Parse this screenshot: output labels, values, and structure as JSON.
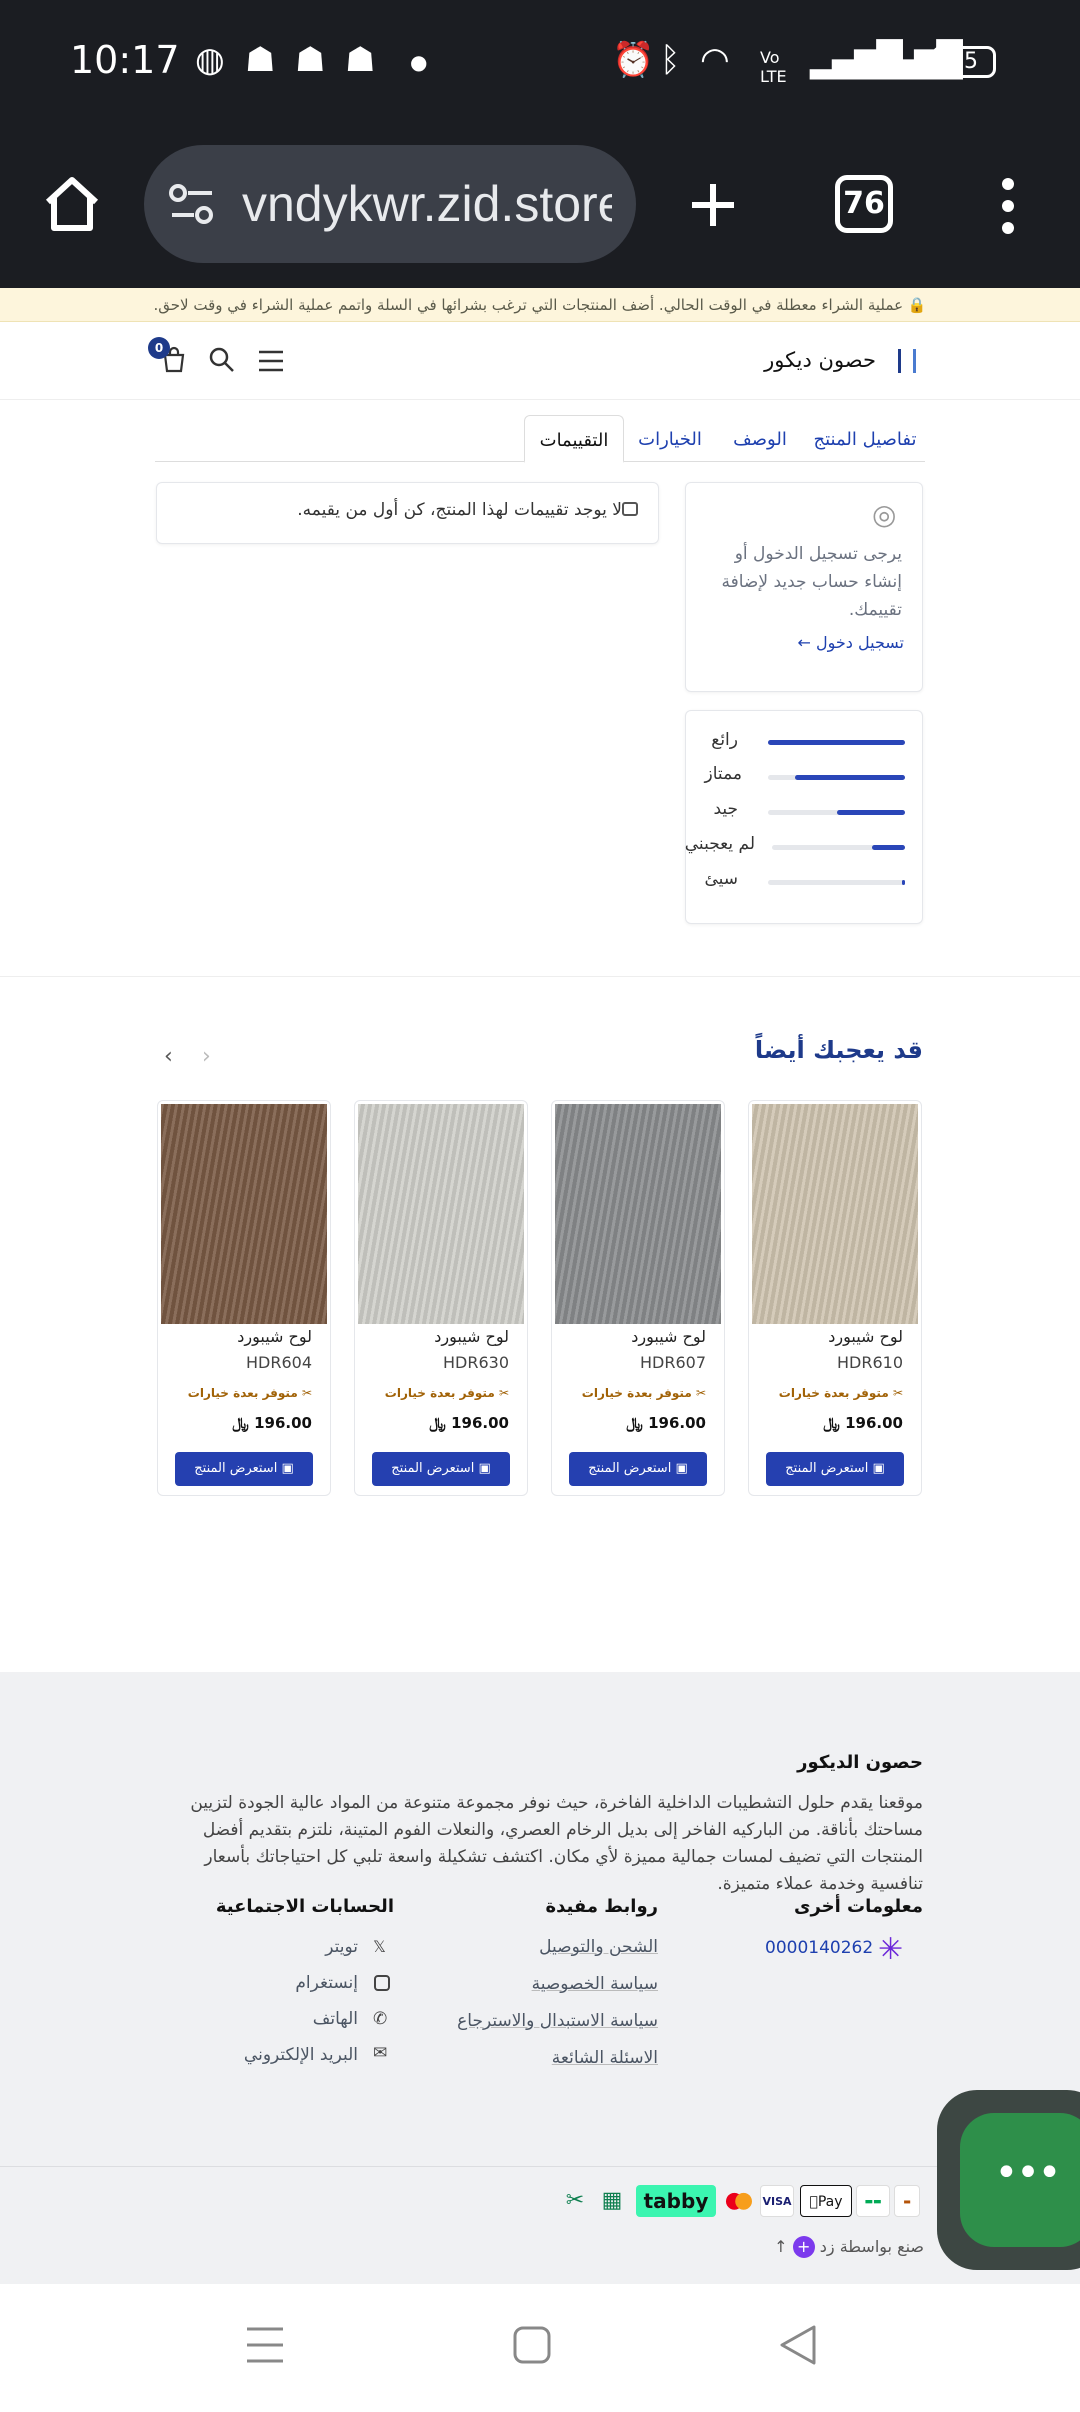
{
  "status": {
    "time": "10:17",
    "battery": "85"
  },
  "browser": {
    "url": "vndykwr.zid.store",
    "tab_count": "76"
  },
  "notice": "عملية الشراء معطلة في الوقت الحالي. أضف المنتجات التي ترغب بشرائها في السلة واتمم عملية الشراء في وقت لاحق.",
  "header": {
    "brand": "حصون ديكور",
    "cart_count": "0"
  },
  "tabs": [
    "تفاصيل المنتج",
    "الوصف",
    "الخيارات",
    "التقييمات"
  ],
  "reviews": {
    "empty": "لا يوجد تقييمات لهذا المنتج، كن أول من يقيمه.",
    "login_prompt": "يرجى تسجيل الدخول أو إنشاء حساب جديد لإضافة تقييمك.",
    "login_link": "تسجيل دخول ←",
    "levels": [
      {
        "label": "رائع",
        "fill": 1.0
      },
      {
        "label": "ممتاز",
        "fill": 0.8
      },
      {
        "label": "جيد",
        "fill": 0.5
      },
      {
        "label": "لم يعجبني",
        "fill": 0.25
      },
      {
        "label": "سيئ",
        "fill": 0.02
      }
    ]
  },
  "related": {
    "title": "قد يعجبك أيضاً",
    "products": [
      {
        "name": "لوح شيبورد",
        "code": "HDR610",
        "availability": "متوفر بعدة خيارات",
        "price": "196.00",
        "button": "استعرض المنتج",
        "swatch": "#cfc4b0"
      },
      {
        "name": "لوح شيبورد",
        "code": "HDR607",
        "availability": "متوفر بعدة خيارات",
        "price": "196.00",
        "button": "استعرض المنتج",
        "swatch": "#8a8c8e"
      },
      {
        "name": "لوح شيبورد",
        "code": "HDR630",
        "availability": "متوفر بعدة خيارات",
        "price": "196.00",
        "button": "استعرض المنتج",
        "swatch": "#cfcfca"
      },
      {
        "name": "لوح شيبورد",
        "code": "HDR604",
        "availability": "متوفر بعدة خيارات",
        "price": "196.00",
        "button": "استعرض المنتج",
        "swatch": "#7a5a44"
      }
    ]
  },
  "footer": {
    "title": "حصون الديكور",
    "about": "موقعنا يقدم حلول التشطيبات الداخلية الفاخرة، حيث نوفر مجموعة متنوعة من المواد عالية الجودة لتزيين مساحتك بأناقة. من الباركيه الفاخر إلى بديل الرخام العصري، والنعلات الفوم المتينة، نلتزم بتقديم أفضل المنتجات التي تضيف لمسات جمالية مميزة لأي مكان. اكتشف تشكيلة واسعة تلبي كل احتياجاتك بأسعار تنافسية وخدمة عملاء متميزة.",
    "other_info_title": "معلومات أخرى",
    "phone_number": "0000140262",
    "links_title": "روابط مفيدة",
    "links": [
      "الشحن والتوصيل",
      "سياسة الخصوصية",
      "سياسة الاستبدال والاسترجاع",
      "الاسئلة الشائعة"
    ],
    "social_title": "الحسابات الاجتماعية",
    "social": [
      "تويتر",
      "إنستغرام",
      "الهاتف",
      "البريد الإلكتروني"
    ],
    "payments": [
      "tabby",
      "Pay",
      "VISA"
    ],
    "made_by": "صنع بواسطة زد"
  },
  "colors": {
    "accent": "#2540b0",
    "brand_blue": "#1e3a8a",
    "fab": "#2e8f4a"
  }
}
